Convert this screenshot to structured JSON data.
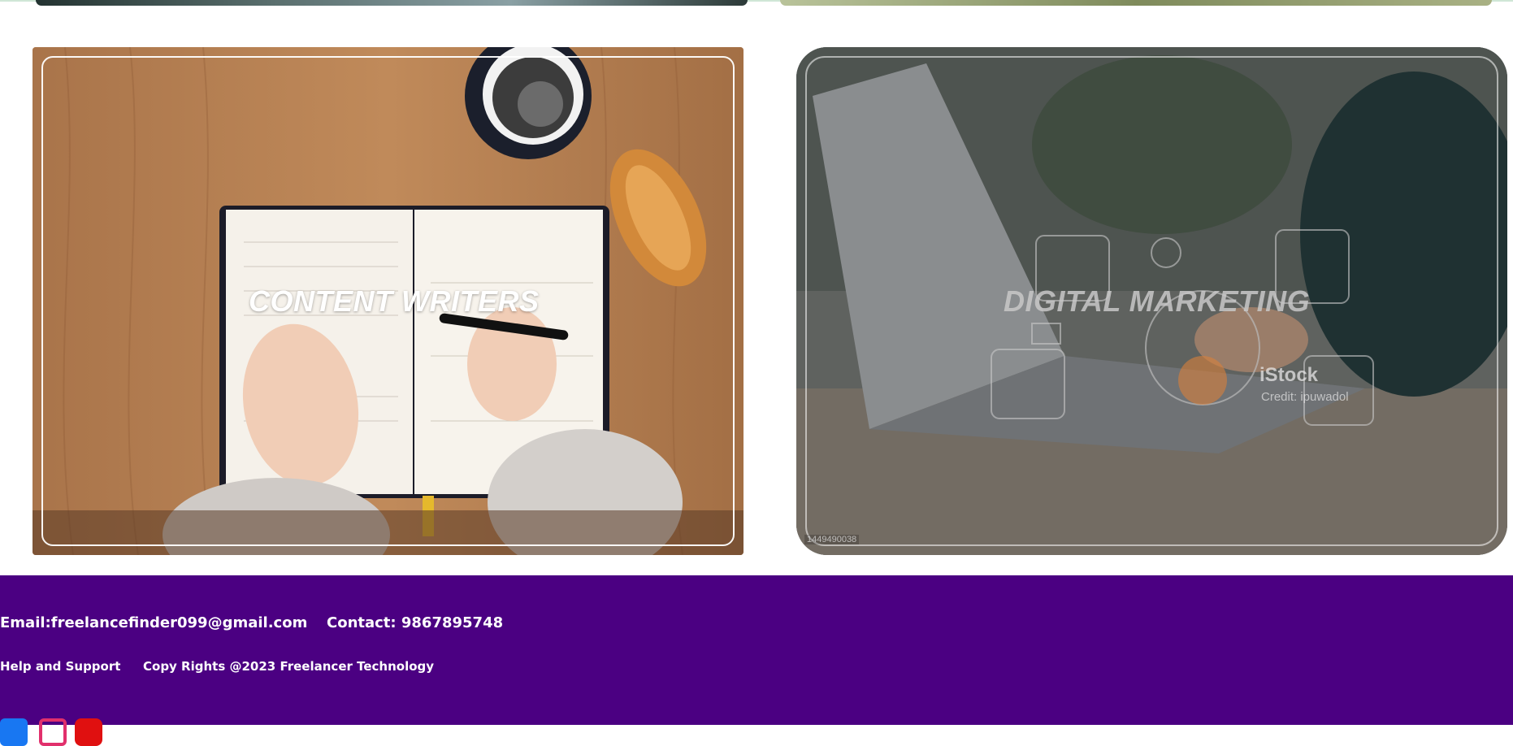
{
  "cards": [
    {
      "title": "CONTENT WRITERS",
      "image": "writer-notebook-photo"
    },
    {
      "title": "DIGITAL MARKETING",
      "image": "laptop-marketing-photo",
      "watermark": "iStock",
      "credit": "Credit: ipuwadol",
      "stock_id": "1449490038"
    }
  ],
  "footer": {
    "email": "Email:freelancefinder099@gmail.com",
    "contact": "Contact: 9867895748",
    "help": "Help and Support",
    "copyright": "Copy Rights @2023 Freelancer Technology",
    "social": [
      "facebook-icon",
      "instagram-icon",
      "youtube-icon"
    ]
  },
  "colors": {
    "footer_bg": "#4b0082",
    "text": "#ffffff"
  }
}
